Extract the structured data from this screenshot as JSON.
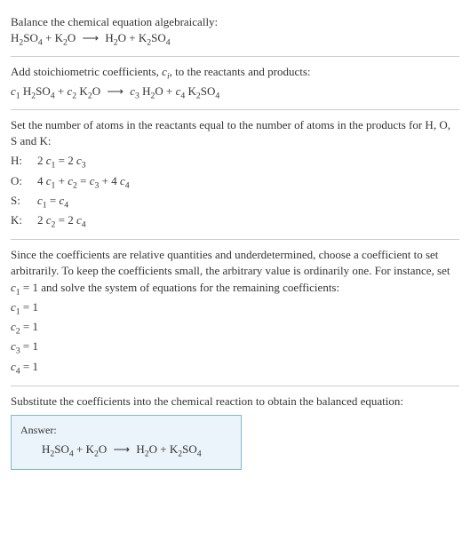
{
  "sec1": {
    "line1": "Balance the chemical equation algebraically:",
    "eq_left1": "H",
    "eq_left1b": "2",
    "eq_left1c": "SO",
    "eq_left1d": "4",
    "plus1": " + K",
    "plus1b": "2",
    "plus1c": "O",
    "arrow": "⟶",
    "eq_right1": "H",
    "eq_right1b": "2",
    "eq_right1c": "O + K",
    "eq_right1d": "2",
    "eq_right1e": "SO",
    "eq_right1f": "4"
  },
  "sec2": {
    "line1a": "Add stoichiometric coefficients, ",
    "line1b": "c",
    "line1c": "i",
    "line1d": ", to the reactants and products:",
    "c1": "c",
    "c1s": "1",
    "sp1": " H",
    "sp1b": "2",
    "sp1c": "SO",
    "sp1d": "4",
    "plus": " + ",
    "c2": "c",
    "c2s": "2",
    "sp2": " K",
    "sp2b": "2",
    "sp2c": "O",
    "arrow": "⟶",
    "c3": "c",
    "c3s": "3",
    "sp3": " H",
    "sp3b": "2",
    "sp3c": "O + ",
    "c4": "c",
    "c4s": "4",
    "sp4": " K",
    "sp4b": "2",
    "sp4c": "SO",
    "sp4d": "4"
  },
  "sec3": {
    "line1": "Set the number of atoms in the reactants equal to the number of atoms in the products for H, O, S and K:",
    "rows": [
      {
        "label": "H:",
        "lhs_a": "2 ",
        "lhs_c": "c",
        "lhs_s": "1",
        "eq": " = 2 ",
        "rhs_c": "c",
        "rhs_s": "3",
        "tail": ""
      },
      {
        "label": "O:",
        "lhs_a": "4 ",
        "lhs_c": "c",
        "lhs_s": "1",
        "mid": " + ",
        "lhs_c2": "c",
        "lhs_s2": "2",
        "eq": " = ",
        "rhs_c": "c",
        "rhs_s": "3",
        "mid2": " + 4 ",
        "rhs_c2": "c",
        "rhs_s2": "4"
      },
      {
        "label": "S:",
        "lhs_a": "",
        "lhs_c": "c",
        "lhs_s": "1",
        "eq": " = ",
        "rhs_c": "c",
        "rhs_s": "4",
        "tail": ""
      },
      {
        "label": "K:",
        "lhs_a": "2 ",
        "lhs_c": "c",
        "lhs_s": "2",
        "eq": " = 2 ",
        "rhs_c": "c",
        "rhs_s": "4",
        "tail": ""
      }
    ]
  },
  "sec4": {
    "para_a": "Since the coefficients are relative quantities and underdetermined, choose a coefficient to set arbitrarily. To keep the coefficients small, the arbitrary value is ordinarily one. For instance, set ",
    "para_c": "c",
    "para_cs": "1",
    "para_b": " = 1 and solve the system of equations for the remaining coefficients:",
    "coeffs": [
      {
        "c": "c",
        "s": "1",
        "v": " = 1"
      },
      {
        "c": "c",
        "s": "2",
        "v": " = 1"
      },
      {
        "c": "c",
        "s": "3",
        "v": " = 1"
      },
      {
        "c": "c",
        "s": "4",
        "v": " = 1"
      }
    ]
  },
  "sec5": {
    "line1": "Substitute the coefficients into the chemical reaction to obtain the balanced equation:",
    "answer_label": "Answer:",
    "eq_l1": "H",
    "eq_l1b": "2",
    "eq_l1c": "SO",
    "eq_l1d": "4",
    "plus": " + K",
    "plusb": "2",
    "plusc": "O",
    "arrow": "⟶",
    "eq_r1": "H",
    "eq_r1b": "2",
    "eq_r1c": "O + K",
    "eq_r1d": "2",
    "eq_r1e": "SO",
    "eq_r1f": "4"
  }
}
